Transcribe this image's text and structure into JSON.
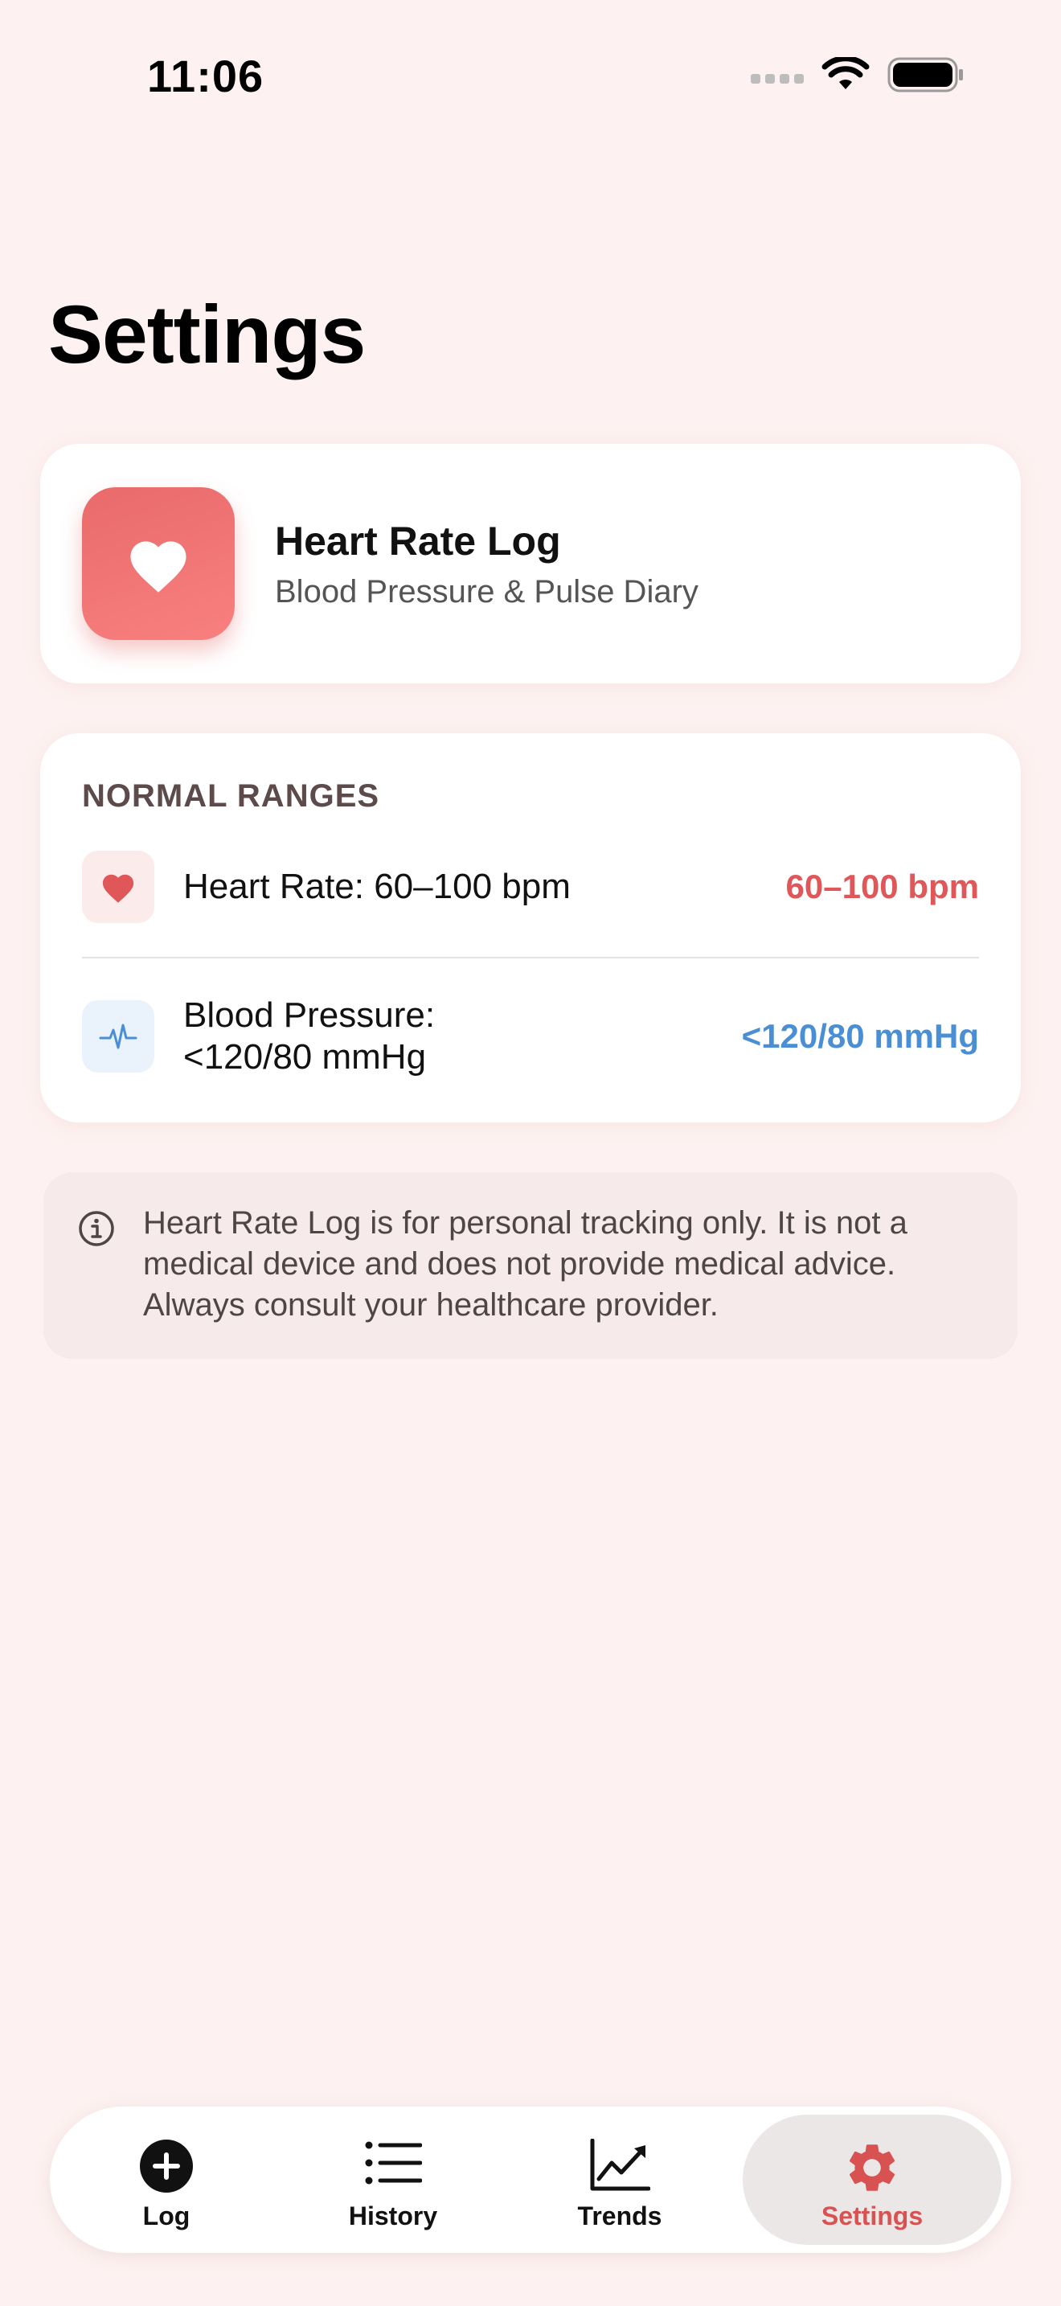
{
  "status_bar": {
    "time": "11:06"
  },
  "page": {
    "title": "Settings"
  },
  "app_info": {
    "name": "Heart Rate Log",
    "subtitle": "Blood Pressure & Pulse Diary",
    "icon": "heart-icon"
  },
  "normal_ranges": {
    "header": "NORMAL RANGES",
    "items": [
      {
        "icon": "heart-icon",
        "label": "Heart Rate: 60–100 bpm",
        "value": "60–100 bpm",
        "color": "#e0575a"
      },
      {
        "icon": "pulse-icon",
        "label": "Blood Pressure: <120/80 mmHg",
        "value": "<120/80 mmHg",
        "color": "#4a8fd4"
      }
    ]
  },
  "disclaimer": {
    "icon": "info-icon",
    "text": "Heart Rate Log is for personal tracking only. It is not a medical device and does not provide medical advice. Always consult your healthcare provider."
  },
  "tab_bar": {
    "tabs": [
      {
        "label": "Log",
        "icon": "plus-circle-icon",
        "selected": false
      },
      {
        "label": "History",
        "icon": "list-icon",
        "selected": false
      },
      {
        "label": "Trends",
        "icon": "chart-icon",
        "selected": false
      },
      {
        "label": "Settings",
        "icon": "gear-icon",
        "selected": true
      }
    ]
  },
  "colors": {
    "accent": "#e0575a",
    "background": "#fdf2f1",
    "blue": "#4a8fd4"
  }
}
